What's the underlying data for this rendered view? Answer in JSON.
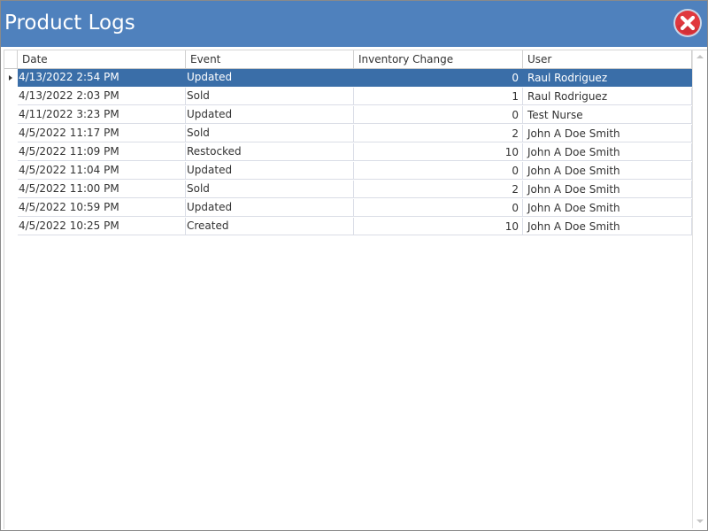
{
  "window": {
    "title": "Product Logs",
    "title_bar_color": "#4f81bd",
    "close_icon": "close-icon",
    "close_icon_color": "#e0383e"
  },
  "grid": {
    "columns": [
      {
        "label": "Date"
      },
      {
        "label": "Event"
      },
      {
        "label": "Inventory Change"
      },
      {
        "label": "User"
      }
    ],
    "selected_row_color": "#3a6ea8",
    "rows": [
      {
        "date": "4/13/2022 2:54 PM",
        "event": "Updated",
        "inventory_change": "0",
        "user": "Raul Rodriguez",
        "selected": true
      },
      {
        "date": "4/13/2022 2:03 PM",
        "event": "Sold",
        "inventory_change": "1",
        "user": "Raul Rodriguez"
      },
      {
        "date": "4/11/2022 3:23 PM",
        "event": "Updated",
        "inventory_change": "0",
        "user": "Test Nurse"
      },
      {
        "date": "4/5/2022 11:17 PM",
        "event": "Sold",
        "inventory_change": "2",
        "user": "John A Doe Smith"
      },
      {
        "date": "4/5/2022 11:09 PM",
        "event": "Restocked",
        "inventory_change": "10",
        "user": "John A Doe Smith"
      },
      {
        "date": "4/5/2022 11:04 PM",
        "event": "Updated",
        "inventory_change": "0",
        "user": "John A Doe Smith"
      },
      {
        "date": "4/5/2022 11:00 PM",
        "event": "Sold",
        "inventory_change": "2",
        "user": "John A Doe Smith"
      },
      {
        "date": "4/5/2022 10:59 PM",
        "event": "Updated",
        "inventory_change": "0",
        "user": "John A Doe Smith"
      },
      {
        "date": "4/5/2022 10:25 PM",
        "event": "Created",
        "inventory_change": "10",
        "user": "John A Doe Smith"
      }
    ]
  }
}
